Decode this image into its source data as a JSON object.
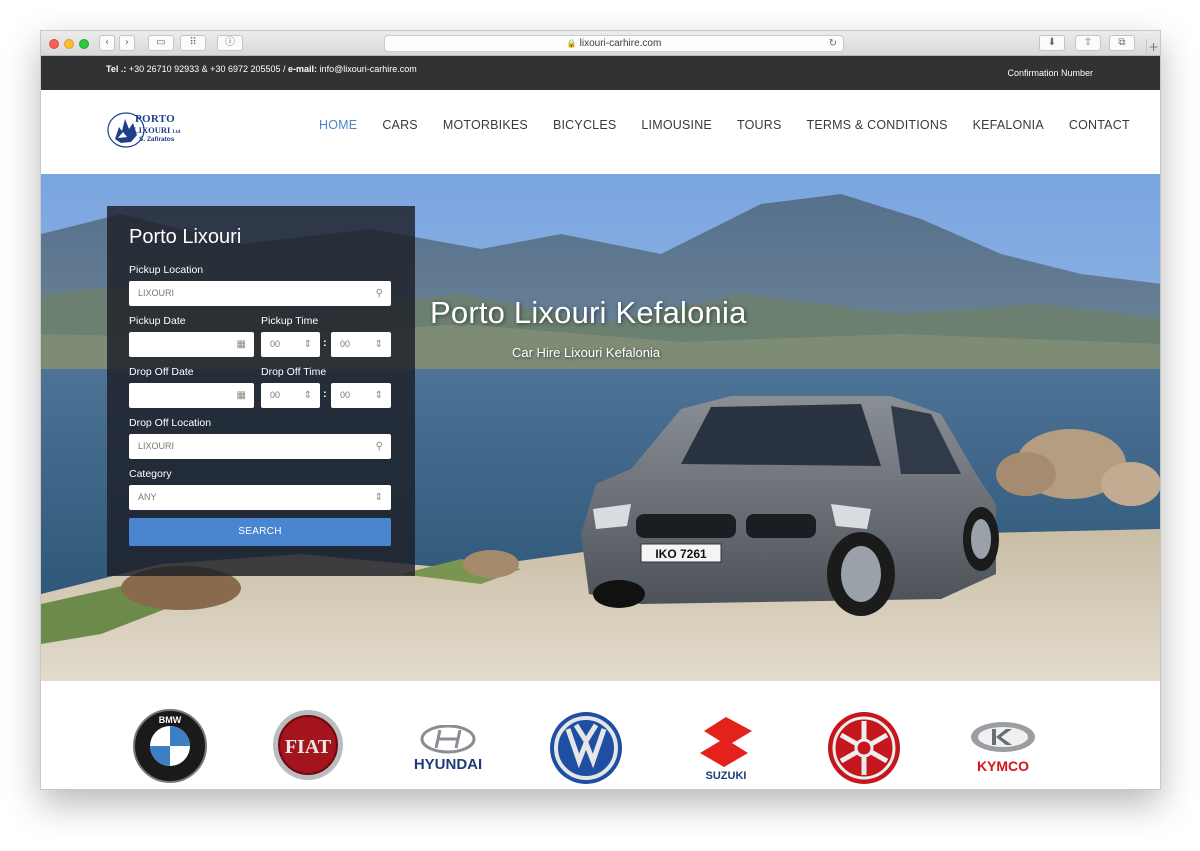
{
  "browser": {
    "url": "lixouri-carhire.com",
    "back_icon": "chevron-left-icon",
    "forward_icon": "chevron-right-icon",
    "sidebar_icon": "sidebar-icon",
    "tabs_icon": "grid-icon",
    "info_icon": "info-icon",
    "reload_icon": "reload-icon",
    "download_icon": "download-icon",
    "share_icon": "share-icon",
    "tabs_overview_icon": "tabs-icon"
  },
  "topbar": {
    "tel_label": "Tel .:",
    "tel_value": "+30 26710 92933 & +30 6972 205505 /",
    "email_label": "e-mail:",
    "email_value": "info@lixouri-carhire.com",
    "confirmation": "Confirmation Number"
  },
  "logo": {
    "line1": "PORTO",
    "line2": "LIXOURI",
    "ltd": "Ltd",
    "line3": "S. Zafiratos"
  },
  "nav": {
    "items": [
      "HOME",
      "CARS",
      "MOTORBIKES",
      "BICYCLES",
      "LIMOUSINE",
      "TOURS",
      "TERMS & CONDITIONS",
      "KEFALONIA",
      "CONTACT"
    ],
    "active": "HOME",
    "active_color": "#4a86c8"
  },
  "hero": {
    "title": "Porto Lixouri Kefalonia",
    "subtitle": "Car Hire Lixouri Kefalonia",
    "plate": "IKO 7261"
  },
  "search": {
    "title": "Porto Lixouri",
    "pickup_location_label": "Pickup Location",
    "pickup_location_value": "LIXOURI",
    "pickup_date_label": "Pickup Date",
    "pickup_time_label": "Pickup Time",
    "pickup_hour": "00",
    "pickup_minute": "00",
    "dropoff_date_label": "Drop Off Date",
    "dropoff_time_label": "Drop Off Time",
    "dropoff_hour": "00",
    "dropoff_minute": "00",
    "dropoff_location_label": "Drop Off Location",
    "dropoff_location_value": "LIXOURI",
    "category_label": "Category",
    "category_value": "ANY",
    "button": "SEARCH",
    "accent": "#4a86cf"
  },
  "brands": {
    "hyundai": "HYUNDAI",
    "suzuki": "SUZUKI",
    "kymco": "KYMCO",
    "fiat": "FIAT",
    "bmw": "BMW"
  }
}
